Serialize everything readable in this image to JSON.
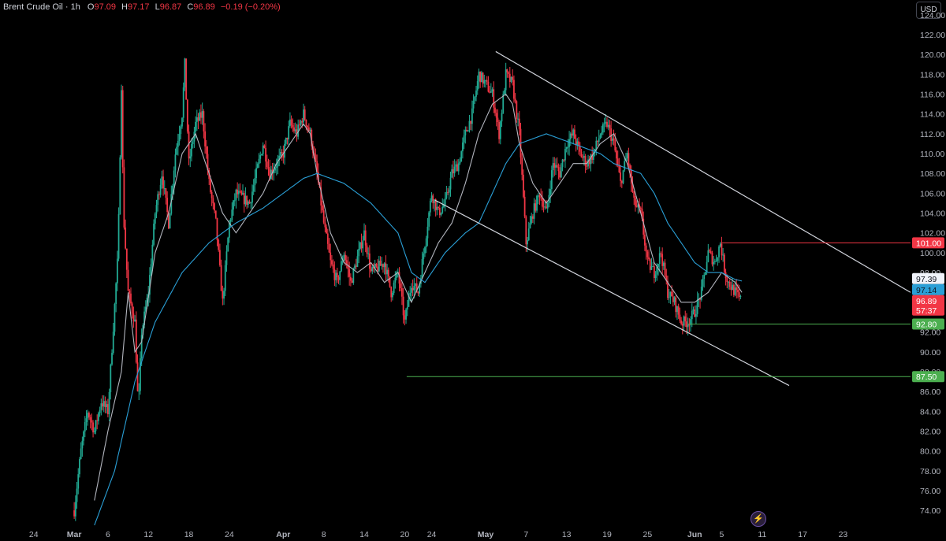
{
  "header": {
    "symbol": "Brent Crude Oil · 1h",
    "open_label": "O",
    "open": "97.09",
    "high_label": "H",
    "high": "97.17",
    "low_label": "L",
    "low": "96.87",
    "close_label": "C",
    "close": "96.89",
    "change": "−0.19 (−0.20%)",
    "currency": "USD",
    "bolt_icon": "lightning-icon"
  },
  "colors": {
    "background": "#000000",
    "up": "#22ab94",
    "down": "#f23645",
    "ma_fast": "#b2b5be",
    "ma_slow": "#2a9fd6",
    "trendline": "#d1d4dc",
    "resistance": "#f23645",
    "support": "#4caf50"
  },
  "chart_data": {
    "type": "candlestick",
    "ylim": [
      72.5,
      125.5
    ],
    "yticks": [
      "124.00",
      "122.00",
      "120.00",
      "118.00",
      "116.00",
      "114.00",
      "112.00",
      "110.00",
      "108.00",
      "106.00",
      "104.00",
      "102.00",
      "100.00",
      "98.00",
      "96.00",
      "94.00",
      "92.00",
      "90.00",
      "88.00",
      "86.00",
      "84.00",
      "82.00",
      "80.00",
      "78.00",
      "76.00",
      "74.00"
    ],
    "x_ticks": [
      {
        "d": -6,
        "label": "24"
      },
      {
        "d": 0,
        "label": "Mar"
      },
      {
        "d": 5,
        "label": "6"
      },
      {
        "d": 11,
        "label": "12"
      },
      {
        "d": 17,
        "label": "18"
      },
      {
        "d": 23,
        "label": "24"
      },
      {
        "d": 31,
        "label": "Apr"
      },
      {
        "d": 37,
        "label": "8"
      },
      {
        "d": 43,
        "label": "14"
      },
      {
        "d": 49,
        "label": "20"
      },
      {
        "d": 53,
        "label": "24"
      },
      {
        "d": 61,
        "label": "May"
      },
      {
        "d": 67,
        "label": "7"
      },
      {
        "d": 73,
        "label": "13"
      },
      {
        "d": 79,
        "label": "19"
      },
      {
        "d": 85,
        "label": "25"
      },
      {
        "d": 92,
        "label": "Jun"
      },
      {
        "d": 96,
        "label": "5"
      },
      {
        "d": 102,
        "label": "11"
      },
      {
        "d": 108,
        "label": "17"
      },
      {
        "d": 114,
        "label": "23"
      }
    ],
    "x_domain": [
      -11,
      124
    ],
    "anchors": [
      [
        0,
        74
      ],
      [
        1,
        80
      ],
      [
        2,
        84
      ],
      [
        3,
        82
      ],
      [
        4,
        85
      ],
      [
        5,
        84
      ],
      [
        6.5,
        100
      ],
      [
        7,
        117
      ],
      [
        7.3,
        104
      ],
      [
        8,
        96
      ],
      [
        9,
        93
      ],
      [
        9.5,
        84
      ],
      [
        10,
        92
      ],
      [
        11,
        96
      ],
      [
        12,
        104
      ],
      [
        13,
        108
      ],
      [
        14,
        103
      ],
      [
        15,
        110
      ],
      [
        16,
        114
      ],
      [
        16.4,
        119
      ],
      [
        17,
        109
      ],
      [
        18,
        113
      ],
      [
        19,
        114
      ],
      [
        20,
        107
      ],
      [
        21,
        103
      ],
      [
        22,
        95
      ],
      [
        23,
        103
      ],
      [
        24,
        106
      ],
      [
        26,
        105
      ],
      [
        28,
        111
      ],
      [
        29,
        108
      ],
      [
        31,
        110
      ],
      [
        32,
        113
      ],
      [
        33,
        112
      ],
      [
        34,
        114
      ],
      [
        35,
        112
      ],
      [
        36,
        108
      ],
      [
        37,
        103
      ],
      [
        38,
        99
      ],
      [
        39,
        97
      ],
      [
        40,
        100
      ],
      [
        41,
        97
      ],
      [
        43,
        102
      ],
      [
        44,
        98
      ],
      [
        46,
        99
      ],
      [
        47,
        96
      ],
      [
        48,
        98
      ],
      [
        49,
        93
      ],
      [
        50,
        97
      ],
      [
        51,
        96
      ],
      [
        52,
        101
      ],
      [
        53,
        106
      ],
      [
        54,
        104
      ],
      [
        55,
        105
      ],
      [
        56,
        108
      ],
      [
        57,
        109
      ],
      [
        58,
        112
      ],
      [
        59,
        114
      ],
      [
        60,
        118
      ],
      [
        61,
        117
      ],
      [
        62,
        116
      ],
      [
        63,
        112
      ],
      [
        64,
        118
      ],
      [
        65,
        117
      ],
      [
        66,
        112
      ],
      [
        67,
        101
      ],
      [
        68,
        104
      ],
      [
        69,
        106
      ],
      [
        70,
        104
      ],
      [
        71,
        109
      ],
      [
        72,
        108
      ],
      [
        73,
        111
      ],
      [
        74,
        112
      ],
      [
        75,
        110
      ],
      [
        76,
        109
      ],
      [
        77,
        110
      ],
      [
        78,
        112
      ],
      [
        79,
        113
      ],
      [
        80,
        111
      ],
      [
        81,
        107
      ],
      [
        82,
        110
      ],
      [
        83,
        105
      ],
      [
        84,
        104
      ],
      [
        85,
        99
      ],
      [
        86,
        98
      ],
      [
        87,
        100
      ],
      [
        88,
        96
      ],
      [
        89,
        95
      ],
      [
        90,
        93
      ],
      [
        91,
        93
      ],
      [
        92,
        94
      ],
      [
        93,
        96
      ],
      [
        94,
        100
      ],
      [
        95,
        99
      ],
      [
        95.8,
        101
      ],
      [
        96.5,
        98
      ],
      [
        97,
        97
      ],
      [
        98,
        96
      ],
      [
        99,
        95
      ]
    ],
    "ma_fast_anchors": [
      [
        3,
        75
      ],
      [
        5,
        82
      ],
      [
        7,
        88
      ],
      [
        8,
        96
      ],
      [
        9,
        90
      ],
      [
        10,
        91
      ],
      [
        12,
        100
      ],
      [
        14,
        104
      ],
      [
        16,
        110
      ],
      [
        18,
        112
      ],
      [
        19,
        110
      ],
      [
        20,
        108
      ],
      [
        22,
        104
      ],
      [
        24,
        102
      ],
      [
        26,
        104
      ],
      [
        28,
        106
      ],
      [
        30,
        109
      ],
      [
        32,
        111
      ],
      [
        34,
        113
      ],
      [
        35,
        112
      ],
      [
        36,
        108
      ],
      [
        38,
        102
      ],
      [
        40,
        99
      ],
      [
        42,
        98
      ],
      [
        44,
        99
      ],
      [
        46,
        97
      ],
      [
        48,
        98
      ],
      [
        50,
        95
      ],
      [
        52,
        98
      ],
      [
        54,
        101
      ],
      [
        56,
        103
      ],
      [
        58,
        107
      ],
      [
        60,
        112
      ],
      [
        62,
        115
      ],
      [
        64,
        116
      ],
      [
        65,
        115
      ],
      [
        66,
        111
      ],
      [
        68,
        107
      ],
      [
        70,
        105
      ],
      [
        72,
        107
      ],
      [
        74,
        109
      ],
      [
        76,
        109
      ],
      [
        78,
        111
      ],
      [
        80,
        112
      ],
      [
        82,
        109
      ],
      [
        84,
        104
      ],
      [
        86,
        99
      ],
      [
        88,
        97
      ],
      [
        90,
        95
      ],
      [
        92,
        95
      ],
      [
        94,
        96
      ],
      [
        96,
        98
      ],
      [
        98,
        97
      ],
      [
        99,
        96
      ]
    ],
    "ma_slow_anchors": [
      [
        3,
        72.5
      ],
      [
        6,
        78
      ],
      [
        9,
        87
      ],
      [
        12,
        93
      ],
      [
        16,
        98
      ],
      [
        20,
        101
      ],
      [
        24,
        103
      ],
      [
        28,
        104.5
      ],
      [
        31,
        106
      ],
      [
        34,
        107.5
      ],
      [
        36,
        108
      ],
      [
        40,
        107
      ],
      [
        44,
        105
      ],
      [
        48,
        102
      ],
      [
        50,
        98
      ],
      [
        52,
        97
      ],
      [
        55,
        100
      ],
      [
        58,
        102
      ],
      [
        60,
        103
      ],
      [
        62,
        106
      ],
      [
        64,
        109
      ],
      [
        66,
        111
      ],
      [
        70,
        112
      ],
      [
        74,
        111
      ],
      [
        78,
        110
      ],
      [
        80,
        109
      ],
      [
        82,
        108.5
      ],
      [
        84,
        108
      ],
      [
        86,
        106
      ],
      [
        88,
        103
      ],
      [
        90,
        101
      ],
      [
        92,
        99
      ],
      [
        94,
        98
      ],
      [
        96,
        98
      ],
      [
        98,
        97.3
      ],
      [
        99,
        97.14
      ]
    ],
    "trendlines": [
      {
        "x1": 62.5,
        "y1": 120.3,
        "x2": 124,
        "y2": 96.0
      },
      {
        "x1": 53.5,
        "y1": 105.3,
        "x2": 106,
        "y2": 86.6
      }
    ],
    "levels": [
      {
        "value": 101.0,
        "start": 96,
        "label": "101.00",
        "kind": "resistance"
      },
      {
        "value": 92.8,
        "start": 91,
        "label": "92.80",
        "kind": "support"
      },
      {
        "value": 87.5,
        "start": 49.3,
        "label": "87.50",
        "kind": "support"
      }
    ],
    "price_badges": [
      {
        "value": 97.39,
        "label": "97.39",
        "bg": "#f0f3fa",
        "fg": "#131722"
      },
      {
        "value": 97.14,
        "label": "97.14",
        "bg": "#2a9fd6",
        "fg": "#131722"
      },
      {
        "value": 96.89,
        "label": "96.89",
        "sub": "57:37",
        "bg": "#f23645",
        "fg": "#ffffff"
      }
    ]
  }
}
